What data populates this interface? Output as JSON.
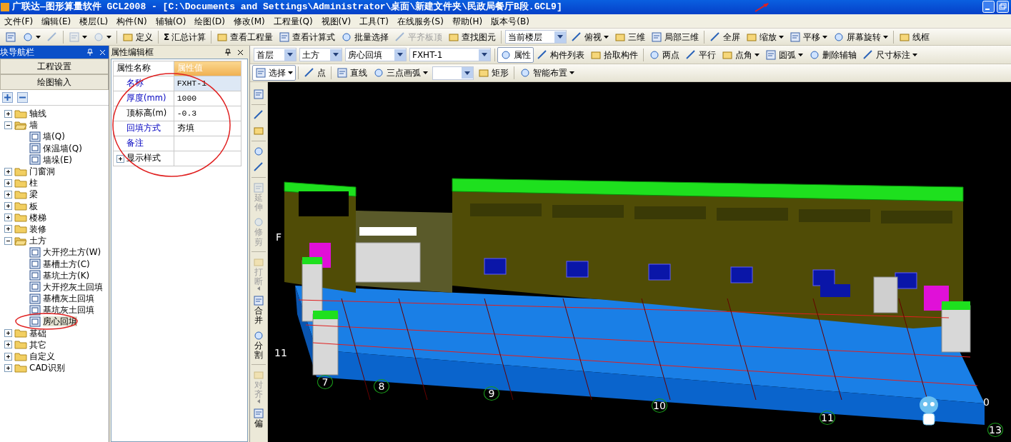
{
  "window": {
    "title": "广联达—图形算量软件 GCL2008 - [C:\\Documents and Settings\\Administrator\\桌面\\新建文件夹\\民政局餐厅B段.GCL9]"
  },
  "menu": [
    "文件(F)",
    "编辑(E)",
    "楼层(L)",
    "构件(N)",
    "辅轴(O)",
    "绘图(D)",
    "修改(M)",
    "工程量(Q)",
    "视图(V)",
    "工具(T)",
    "在线服务(S)",
    "帮助(H)",
    "版本号(B)"
  ],
  "main_toolbar": [
    {
      "kind": "icon",
      "dropdown": false,
      "disabled": false
    },
    {
      "kind": "icon",
      "dropdown": true,
      "disabled": false
    },
    {
      "kind": "icon",
      "dropdown": false,
      "disabled": true
    },
    {
      "kind": "sep"
    },
    {
      "kind": "icon",
      "dropdown": true,
      "disabled": true
    },
    {
      "kind": "icon",
      "dropdown": true,
      "disabled": true
    },
    {
      "kind": "sep"
    },
    {
      "kind": "tool",
      "label": "定义",
      "dropdown": false,
      "disabled": false
    },
    {
      "kind": "sep"
    },
    {
      "kind": "tool",
      "glyph": "Σ",
      "label": "汇总计算",
      "dropdown": false,
      "disabled": false
    },
    {
      "kind": "sep"
    },
    {
      "kind": "tool",
      "label": "查看工程量",
      "dropdown": false,
      "disabled": false
    },
    {
      "kind": "tool",
      "label": "查看计算式",
      "dropdown": false,
      "disabled": false
    },
    {
      "kind": "tool",
      "label": "批量选择",
      "dropdown": false,
      "disabled": false
    },
    {
      "kind": "tool",
      "label": "平齐板顶",
      "dropdown": false,
      "disabled": true
    },
    {
      "kind": "tool",
      "label": "查找图元",
      "dropdown": false,
      "disabled": false
    },
    {
      "kind": "sep"
    },
    {
      "kind": "select",
      "value": "当前楼层"
    },
    {
      "kind": "tool",
      "label": "俯视",
      "dropdown": true,
      "disabled": false
    },
    {
      "kind": "tool",
      "label": "三维",
      "dropdown": false,
      "disabled": false
    },
    {
      "kind": "tool",
      "label": "局部三维",
      "dropdown": false,
      "disabled": false
    },
    {
      "kind": "sep"
    },
    {
      "kind": "tool",
      "label": "全屏",
      "dropdown": false,
      "disabled": false
    },
    {
      "kind": "tool",
      "label": "缩放",
      "dropdown": true,
      "disabled": false
    },
    {
      "kind": "tool",
      "label": "平移",
      "dropdown": true,
      "disabled": false
    },
    {
      "kind": "tool",
      "label": "屏幕旋转",
      "dropdown": true,
      "disabled": false
    },
    {
      "kind": "sep"
    },
    {
      "kind": "tool",
      "label": "线框",
      "dropdown": false,
      "disabled": false
    }
  ],
  "nav_panel": {
    "title": "块导航栏",
    "sections": [
      "工程设置",
      "绘图输入"
    ],
    "tree": [
      {
        "kind": "folder",
        "label": "轴线",
        "expanded": false
      },
      {
        "kind": "folder",
        "label": "墙",
        "expanded": true,
        "children": [
          {
            "kind": "item",
            "label": "墙(Q)",
            "selected": false
          },
          {
            "kind": "item",
            "label": "保温墙(Q)",
            "selected": false
          },
          {
            "kind": "item",
            "label": "墙垛(E)",
            "selected": false
          }
        ]
      },
      {
        "kind": "folder",
        "label": "门窗洞",
        "expanded": false
      },
      {
        "kind": "folder",
        "label": "柱",
        "expanded": false
      },
      {
        "kind": "folder",
        "label": "梁",
        "expanded": false
      },
      {
        "kind": "folder",
        "label": "板",
        "expanded": false
      },
      {
        "kind": "folder",
        "label": "楼梯",
        "expanded": false
      },
      {
        "kind": "folder",
        "label": "装修",
        "expanded": false
      },
      {
        "kind": "folder",
        "label": "土方",
        "expanded": true,
        "children": [
          {
            "kind": "item",
            "label": "大开挖土方(W)",
            "selected": false
          },
          {
            "kind": "item",
            "label": "基槽土方(C)",
            "selected": false
          },
          {
            "kind": "item",
            "label": "基坑土方(K)",
            "selected": false
          },
          {
            "kind": "item",
            "label": "大开挖灰土回填",
            "selected": false
          },
          {
            "kind": "item",
            "label": "基槽灰土回填",
            "selected": false
          },
          {
            "kind": "item",
            "label": "基坑灰土回填",
            "selected": false
          },
          {
            "kind": "item",
            "label": "房心回填",
            "selected": true
          }
        ]
      },
      {
        "kind": "folder",
        "label": "基础",
        "expanded": false
      },
      {
        "kind": "folder",
        "label": "其它",
        "expanded": false
      },
      {
        "kind": "folder",
        "label": "自定义",
        "expanded": false
      },
      {
        "kind": "folder",
        "label": "CAD识别",
        "expanded": false
      }
    ]
  },
  "property_panel": {
    "title": "属性编辑框",
    "columns": [
      "属性名称",
      "属性值"
    ],
    "rows": [
      {
        "name": "名称",
        "value": "FXHT-1",
        "kind": "common",
        "selected": true,
        "expandable": false
      },
      {
        "name": "厚度(mm)",
        "value": "1000",
        "kind": "common",
        "selected": false,
        "expandable": false
      },
      {
        "name": "顶标高(m)",
        "value": "-0.3",
        "kind": "private",
        "selected": false,
        "expandable": false
      },
      {
        "name": "回填方式",
        "value": "夯填",
        "kind": "common",
        "selected": false,
        "expandable": false
      },
      {
        "name": "备注",
        "kind": "common",
        "selected": false,
        "expandable": false
      },
      {
        "name": "显示样式",
        "kind": "private",
        "selected": false,
        "expandable": true
      }
    ]
  },
  "draw_toolbar_1": [
    {
      "kind": "select",
      "value": "首层"
    },
    {
      "kind": "select",
      "value": "土方"
    },
    {
      "kind": "select",
      "value": "房心回填"
    },
    {
      "kind": "select",
      "value": "FXHT-1"
    },
    {
      "kind": "sep"
    },
    {
      "kind": "tool",
      "label": "属性",
      "dropdown": false,
      "pressed": true
    },
    {
      "kind": "tool",
      "label": "构件列表",
      "dropdown": false,
      "pressed": false
    },
    {
      "kind": "tool",
      "label": "拾取构件",
      "dropdown": false,
      "pressed": false
    },
    {
      "kind": "sep"
    },
    {
      "kind": "tool",
      "label": "两点",
      "dropdown": false,
      "pressed": false
    },
    {
      "kind": "tool",
      "label": "平行",
      "dropdown": false,
      "pressed": false
    },
    {
      "kind": "tool",
      "label": "点角",
      "dropdown": true,
      "pressed": false
    },
    {
      "kind": "tool",
      "label": "圆弧",
      "dropdown": true,
      "pressed": false
    },
    {
      "kind": "tool",
      "label": "删除辅轴",
      "dropdown": false,
      "pressed": false
    },
    {
      "kind": "tool",
      "label": "尺寸标注",
      "dropdown": true,
      "pressed": false
    }
  ],
  "draw_toolbar_2": [
    {
      "kind": "tool",
      "label": "选择",
      "dropdown": true,
      "pressed": true
    },
    {
      "kind": "sep"
    },
    {
      "kind": "tool",
      "label": "点",
      "dropdown": false,
      "pressed": false
    },
    {
      "kind": "sep"
    },
    {
      "kind": "tool",
      "label": "直线",
      "dropdown": false,
      "pressed": false
    },
    {
      "kind": "tool",
      "label": "三点画弧",
      "dropdown": true,
      "pressed": false
    },
    {
      "kind": "select"
    },
    {
      "kind": "tool",
      "label": "矩形",
      "dropdown": false,
      "pressed": false
    },
    {
      "kind": "sep"
    },
    {
      "kind": "tool",
      "label": "智能布置",
      "dropdown": true,
      "pressed": false
    }
  ],
  "edit_toolbar": [
    {
      "kind": "icon",
      "disabled": false
    },
    {
      "kind": "sep"
    },
    {
      "kind": "icon",
      "disabled": false
    },
    {
      "kind": "icon",
      "disabled": false
    },
    {
      "kind": "sep"
    },
    {
      "kind": "icon",
      "disabled": false
    },
    {
      "kind": "icon",
      "disabled": false
    },
    {
      "kind": "sep"
    },
    {
      "kind": "tool",
      "label": "延伸",
      "dropdown": false,
      "disabled": true
    },
    {
      "kind": "tool",
      "label": "修剪",
      "dropdown": false,
      "disabled": true
    },
    {
      "kind": "sep"
    },
    {
      "kind": "tool",
      "label": "打断",
      "dropdown": true,
      "disabled": true
    },
    {
      "kind": "tool",
      "label": "合并",
      "dropdown": false,
      "disabled": false
    },
    {
      "kind": "tool",
      "label": "分割",
      "dropdown": false,
      "disabled": false
    },
    {
      "kind": "sep"
    },
    {
      "kind": "tool",
      "label": "对齐",
      "dropdown": true,
      "disabled": true
    },
    {
      "kind": "tool",
      "label": "偏",
      "dropdown": false,
      "disabled": false
    }
  ],
  "viewport": {
    "axis_labels": [
      "7",
      "8",
      "9",
      "10",
      "11",
      "13"
    ],
    "side_labels": [
      "F",
      "11",
      "0"
    ]
  }
}
